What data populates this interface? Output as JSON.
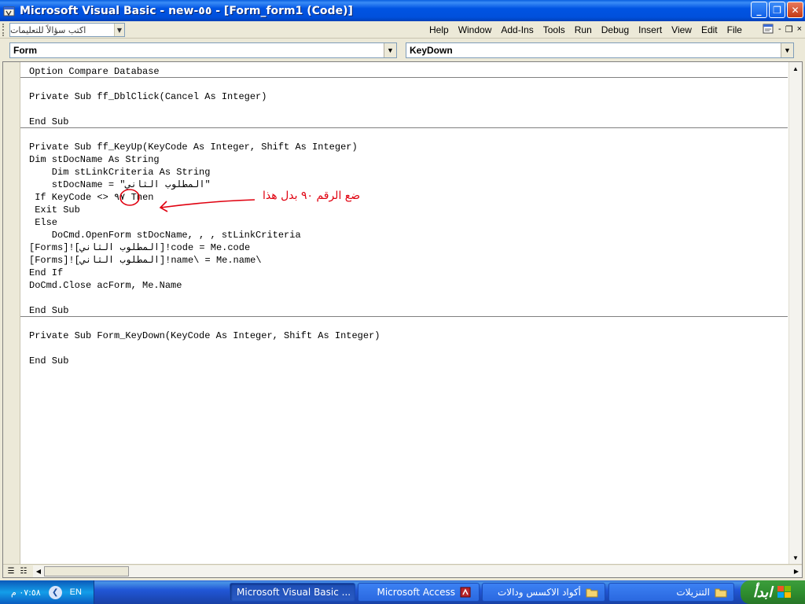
{
  "window": {
    "title": "Microsoft Visual Basic - new-٥٥ - [Form_form1 (Code)]",
    "min": "_",
    "max": "❐",
    "close": "✕"
  },
  "menubar": {
    "ask_placeholder": "اكتب سؤالاً للتعليمات",
    "items": [
      "Help",
      "Window",
      "Add-Ins",
      "Tools",
      "Run",
      "Debug",
      "Insert",
      "View",
      "Edit",
      "File"
    ],
    "mdi_min": "-",
    "mdi_restore": "❐",
    "mdi_close": "×"
  },
  "combos": {
    "object": "Form",
    "procedure": "KeyDown"
  },
  "code": {
    "block1": [
      "Option Compare Database",
      "",
      "Private Sub ff_DblClick(Cancel As Integer)",
      "",
      "End Sub"
    ],
    "block2": [
      "Private Sub ff_KeyUp(KeyCode As Integer, Shift As Integer)",
      "Dim stDocName As String",
      "    Dim stLinkCriteria As String",
      "    stDocName = \"المطلوب الثاني\"",
      " If KeyCode <> ٩٧ Then",
      " Exit Sub",
      " Else",
      "    DoCmd.OpenForm stDocName, , , stLinkCriteria",
      "[Forms]![المطلوب الثاني]!code = Me.code",
      "[Forms]![المطلوب الثاني]!name\\ = Me.name\\",
      "End If",
      "DoCmd.Close acForm, Me.Name",
      "",
      "End Sub"
    ],
    "block3": [
      "Private Sub Form_KeyDown(KeyCode As Integer, Shift As Integer)",
      "",
      "End Sub"
    ]
  },
  "annotation": {
    "text": "ضع الرقم ٩٠ بدل هذا",
    "color": "#e0000f"
  },
  "taskbar": {
    "clock": "٠٧:٥٨ م",
    "lang": "EN",
    "tasks": [
      "Microsoft Visual Basic ...",
      "Microsoft Access",
      "أكواد الاكسس ودالات",
      "التنزيلات"
    ],
    "start": "ابدأ"
  }
}
